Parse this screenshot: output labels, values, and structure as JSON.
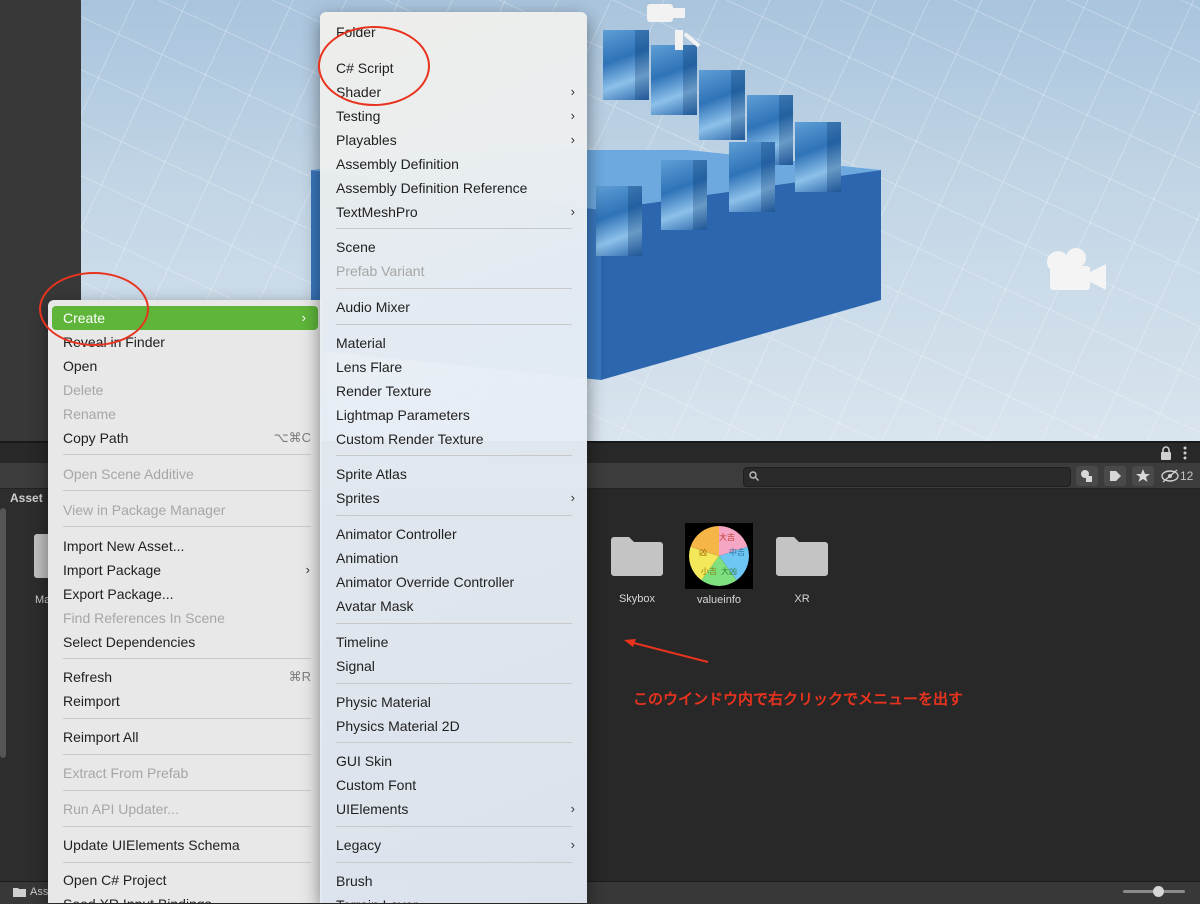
{
  "colors": {
    "highlight": "#5fb53a",
    "annotation": "#e8331e",
    "menu_bg": "#e8e8e8",
    "disabled_text": "#a6a6a6"
  },
  "toolbar": {
    "hidden_count": "12"
  },
  "project": {
    "header": "Asset",
    "partial_item": "Ma",
    "items": [
      {
        "label": "Skybox",
        "icon": "folder-icon"
      },
      {
        "label": "valueinfo",
        "icon": "fortune-wheel-thumbnail"
      },
      {
        "label": "XR",
        "icon": "folder-icon"
      }
    ],
    "bottom_path": "Ass"
  },
  "wheel": {
    "labels": [
      "大吉",
      "中吉",
      "大凶",
      "小吉",
      "凶"
    ]
  },
  "context_menu": {
    "items": [
      {
        "label": "Create",
        "state": "highlight",
        "arrow": "›"
      },
      {
        "label": "Reveal in Finder"
      },
      {
        "label": "Open"
      },
      {
        "label": "Delete",
        "state": "disabled"
      },
      {
        "label": "Rename",
        "state": "disabled"
      },
      {
        "label": "Copy Path",
        "shortcut": "⌥⌘C"
      },
      {
        "label": "Open Scene Additive",
        "state": "disabled"
      },
      {
        "label": "View in Package Manager",
        "state": "disabled"
      },
      {
        "label": "Import New Asset..."
      },
      {
        "label": "Import Package",
        "arrow": "›"
      },
      {
        "label": "Export Package..."
      },
      {
        "label": "Find References In Scene",
        "state": "disabled"
      },
      {
        "label": "Select Dependencies"
      },
      {
        "label": "Refresh",
        "shortcut": "⌘R"
      },
      {
        "label": "Reimport"
      },
      {
        "label": "Reimport All"
      },
      {
        "label": "Extract From Prefab",
        "state": "disabled"
      },
      {
        "label": "Run API Updater...",
        "state": "disabled"
      },
      {
        "label": "Update UIElements Schema"
      },
      {
        "label": "Open C# Project"
      },
      {
        "label": "Seed XR Input Bindings"
      }
    ]
  },
  "create_submenu": {
    "items": [
      {
        "label": "Folder"
      },
      {
        "label": "C# Script"
      },
      {
        "label": "Shader",
        "arrow": "›"
      },
      {
        "label": "Testing",
        "arrow": "›"
      },
      {
        "label": "Playables",
        "arrow": "›"
      },
      {
        "label": "Assembly Definition"
      },
      {
        "label": "Assembly Definition Reference"
      },
      {
        "label": "TextMeshPro",
        "arrow": "›"
      },
      {
        "label": "Scene"
      },
      {
        "label": "Prefab Variant",
        "state": "disabled"
      },
      {
        "label": "Audio Mixer"
      },
      {
        "label": "Material"
      },
      {
        "label": "Lens Flare"
      },
      {
        "label": "Render Texture"
      },
      {
        "label": "Lightmap Parameters"
      },
      {
        "label": "Custom Render Texture"
      },
      {
        "label": "Sprite Atlas"
      },
      {
        "label": "Sprites",
        "arrow": "›"
      },
      {
        "label": "Animator Controller"
      },
      {
        "label": "Animation"
      },
      {
        "label": "Animator Override Controller"
      },
      {
        "label": "Avatar Mask"
      },
      {
        "label": "Timeline"
      },
      {
        "label": "Signal"
      },
      {
        "label": "Physic Material"
      },
      {
        "label": "Physics Material 2D"
      },
      {
        "label": "GUI Skin"
      },
      {
        "label": "Custom Font"
      },
      {
        "label": "UIElements",
        "arrow": "›"
      },
      {
        "label": "Legacy",
        "arrow": "›"
      },
      {
        "label": "Brush"
      },
      {
        "label": "Terrain Layer"
      }
    ]
  },
  "annotation": {
    "text": "このウインドウ内で右クリックでメニューを出す"
  }
}
